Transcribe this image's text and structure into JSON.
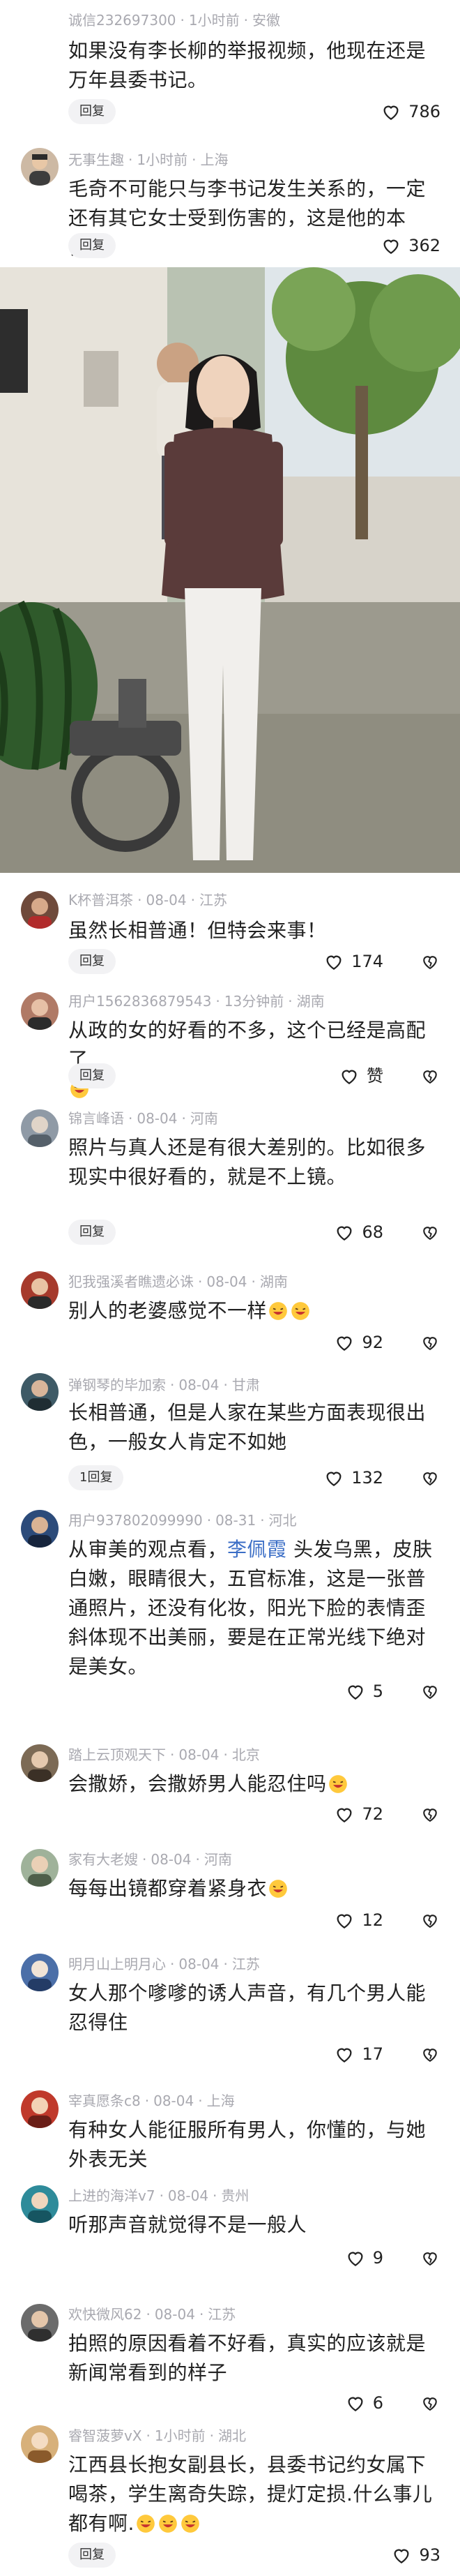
{
  "comments": [
    {
      "user": "诚信232697300",
      "time": "1小时前",
      "location": "安徽",
      "text": "如果没有李长柳的举报视频，他现在还是万年县委书记。",
      "reply": "回复",
      "likes": "786"
    },
    {
      "user": "无事生趣",
      "time": "1小时前",
      "location": "上海",
      "text": "毛奇不可能只与李书记发生关系的，一定还有其它女士受到伤害的，这是他的本性！",
      "reply": "回复",
      "likes": "362"
    },
    {
      "user": "K杯普洱茶",
      "time": "08-04",
      "location": "江苏",
      "text": "虽然长相普通！但特会来事！",
      "reply": "回复",
      "likes": "174"
    },
    {
      "user": "用户1562836879543",
      "time": "13分钟前",
      "location": "湖南",
      "text": "从政的女的好看的不多，这个已经是高配了",
      "reply": "回复",
      "likes": "赞"
    },
    {
      "user": "锦言峰语",
      "time": "08-04",
      "location": "河南",
      "text": "照片与真人还是有很大差别的。比如很多现实中很好看的，就是不上镜。",
      "reply": "回复",
      "likes": "68"
    },
    {
      "user": "犯我强溪者瞧遗必诛",
      "time": "08-04",
      "location": "湖南",
      "text": "别人的老婆感觉不一样",
      "likes": "92"
    },
    {
      "user": "弹钢琴的毕加索",
      "time": "08-04",
      "location": "甘肃",
      "text": "长相普通，但是人家在某些方面表现很出色，一般女人肯定不如她",
      "reply": "1回复",
      "likes": "132"
    },
    {
      "user": "用户937802099990",
      "time": "08-31",
      "location": "河北",
      "text_pre": "从审美的观点看，",
      "mention": "李佩霞",
      "text_post": "头发乌黑，皮肤白嫩，眼睛很大，五官标准，这是一张普通照片，还没有化妆，阳光下脸的表情歪斜体现不出美丽，要是在正常光线下绝对是美女。",
      "likes": "5"
    },
    {
      "user": "踏上云顶观天下",
      "time": "08-04",
      "location": "北京",
      "text": "会撒娇，会撒娇男人能忍住吗",
      "likes": "72"
    },
    {
      "user": "家有大老嫂",
      "time": "08-04",
      "location": "河南",
      "text": "每每出镜都穿着紧身衣",
      "likes": "12"
    },
    {
      "user": "明月山上明月心",
      "time": "08-04",
      "location": "江苏",
      "text": "女人那个嗲嗲的诱人声音，有几个男人能忍得住",
      "likes": "17"
    },
    {
      "user": "宰真愿条c8",
      "time": "08-04",
      "location": "上海",
      "text": "有种女人能征服所有男人，你懂的，与她外表无关",
      "likes": ""
    },
    {
      "user": "上进的海洋v7",
      "time": "08-04",
      "location": "贵州",
      "text": "听那声音就觉得不是一般人",
      "likes": "9"
    },
    {
      "user": "欢快微风62",
      "time": "08-04",
      "location": "江苏",
      "text": "拍照的原因看着不好看，真实的应该就是新闻常看到的样子",
      "likes": "6"
    },
    {
      "user": "睿智菠萝vX",
      "time": "1小时前",
      "location": "湖北",
      "text": "江西县长抱女副县长，县委书记约女属下喝茶，学生离奇失踪，提灯定损.什么事儿都有啊.",
      "reply": "回复",
      "likes": "93"
    }
  ],
  "colors": {
    "text": "#222222",
    "meta": "#a9a9b0",
    "mention": "#3b6ec6",
    "reply_bg": "#f2f2f4"
  }
}
